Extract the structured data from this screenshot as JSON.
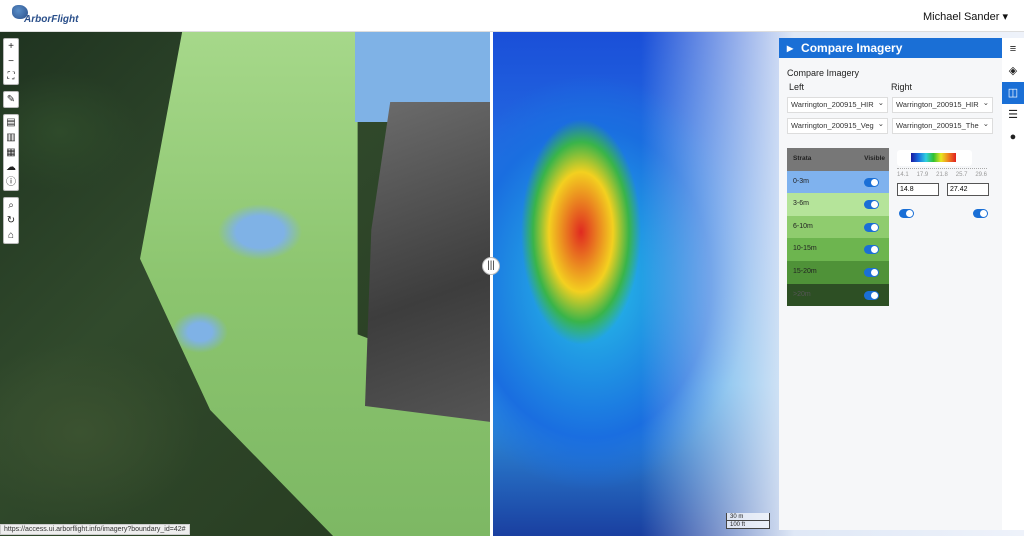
{
  "header": {
    "logo_text": "ArborFlight",
    "user_name": "Michael Sander ▾"
  },
  "toolbar": {
    "groups": [
      [
        {
          "icon": "zoom-in-icon",
          "glyph": "+"
        },
        {
          "icon": "zoom-out-icon",
          "glyph": "−"
        },
        {
          "icon": "fullscreen-icon",
          "glyph": "⛶"
        }
      ],
      [
        {
          "icon": "edit-icon",
          "glyph": "✎"
        }
      ],
      [
        {
          "icon": "export-file-icon",
          "glyph": "▤"
        },
        {
          "icon": "import-file-icon",
          "glyph": "▥"
        },
        {
          "icon": "document-icon",
          "glyph": "▦"
        },
        {
          "icon": "cloud-upload-icon",
          "glyph": "☁"
        },
        {
          "icon": "info-icon",
          "glyph": "ⓘ"
        }
      ],
      [
        {
          "icon": "search-icon",
          "glyph": "⌕"
        },
        {
          "icon": "search-refresh-icon",
          "glyph": "↻"
        },
        {
          "icon": "home-icon",
          "glyph": "⌂"
        }
      ]
    ]
  },
  "panel": {
    "header": "Compare Imagery",
    "title": "Compare Imagery",
    "left_label": "Left",
    "right_label": "Right",
    "left_select_1": "Warrington_200915_HIR",
    "right_select_1": "Warrington_200915_HIR",
    "left_select_2": "Warrington_200915_Veg",
    "right_select_2": "Warrington_200915_The",
    "strata_header": "Strata",
    "visible_header": "Visible",
    "strata": [
      {
        "label": "0-3m",
        "color": "#7fb2ee",
        "visible": true
      },
      {
        "label": "3-6m",
        "color": "#b5e49a",
        "visible": true
      },
      {
        "label": "6-10m",
        "color": "#8fcc6e",
        "visible": true
      },
      {
        "label": "10-15m",
        "color": "#6db54f",
        "visible": true
      },
      {
        "label": "15-20m",
        "color": "#4f9238",
        "visible": true
      },
      {
        "label": ">20m",
        "color": "#2d4f24",
        "visible": true
      }
    ],
    "range_ticks": [
      "14.1",
      "17.9",
      "21.8",
      "25.7",
      "29.6"
    ],
    "range_min": "14.8",
    "range_max": "27.42",
    "toggle_left": true,
    "toggle_right": true
  },
  "side_nav": [
    {
      "icon": "menu-icon",
      "glyph": "≡"
    },
    {
      "icon": "layers-icon",
      "glyph": "◈"
    },
    {
      "icon": "compare-icon",
      "glyph": "◫",
      "active": true
    },
    {
      "icon": "list-icon",
      "glyph": "☰"
    },
    {
      "icon": "map-marker-icon",
      "glyph": "●"
    }
  ],
  "scale": {
    "metric": "30 m",
    "imperial": "100 ft"
  },
  "status_url": "https://access.ui.arborflight.info/imagery?boundary_id=42#",
  "colors": {
    "accent": "#1a6fd6"
  }
}
